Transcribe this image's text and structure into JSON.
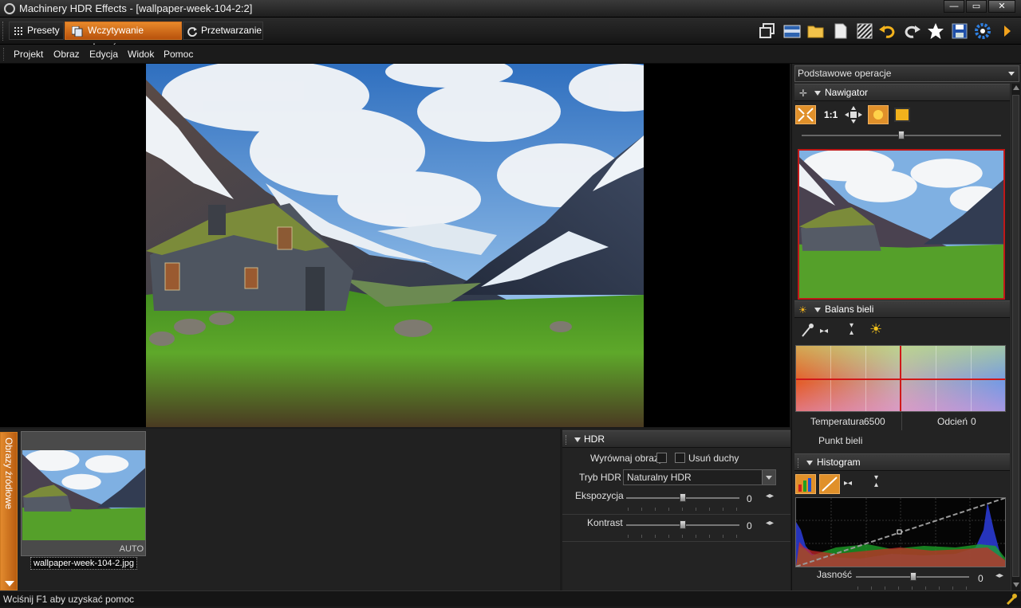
{
  "window": {
    "title": "Machinery HDR Effects - [wallpaper-week-104-2:2]"
  },
  "toolbar": {
    "tabs": [
      {
        "label": "Presety"
      },
      {
        "label": "Wczytywanie obrazów"
      },
      {
        "label": "Przetwarzanie"
      }
    ]
  },
  "menu": [
    "Projekt",
    "Obraz",
    "Edycja",
    "Widok",
    "Pomoc"
  ],
  "filmstrip": {
    "side_label": "Obrazy źródłowe",
    "thumb_badge": "AUTO",
    "file_name": "wallpaper-week-104-2.jpg"
  },
  "hdr": {
    "title": "HDR",
    "align_label": "Wyrównaj obrazy",
    "ghost_label": "Usuń duchy",
    "mode_label": "Tryb HDR",
    "mode_value": "Naturalny HDR",
    "exposure_label": "Ekspozycja",
    "exposure_value": "0",
    "contrast_label": "Kontrast",
    "contrast_value": "0"
  },
  "right": {
    "dropdown": "Podstawowe operacje",
    "navigator_title": "Nawigator",
    "zoom_label": "1:1",
    "wb_title": "Balans bieli",
    "temp_label": "Temperatura",
    "temp_value": "6500",
    "tint_label": "Odcień",
    "tint_value": "0",
    "white_point_label": "Punkt bieli",
    "histogram_title": "Histogram",
    "brightness_label": "Jasność",
    "brightness_value": "0"
  },
  "status": {
    "text": "Wciśnij F1 aby uzyskać pomoc"
  }
}
